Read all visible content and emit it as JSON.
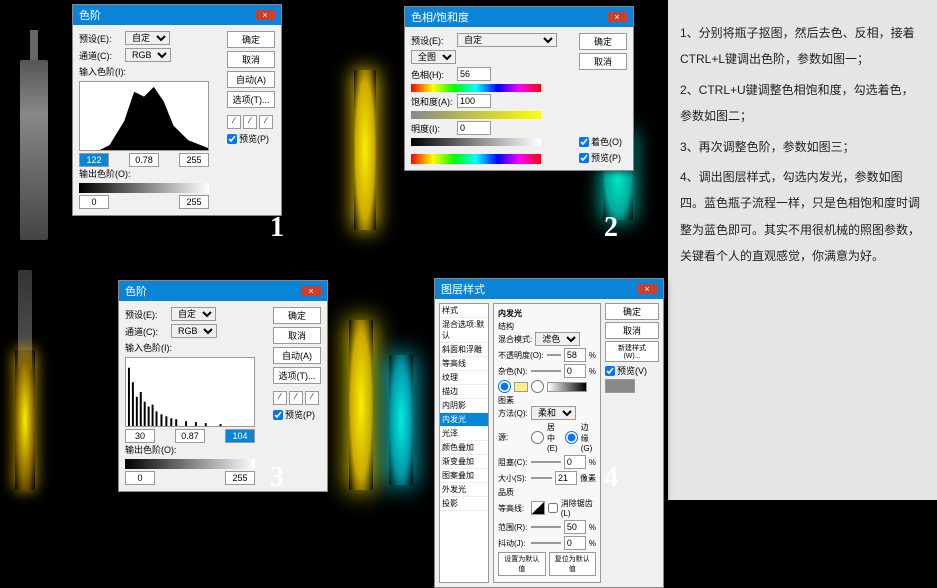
{
  "instructions": [
    "1、分别将瓶子抠图，然后去色、反相，接着CTRL+L键调出色阶，参数如图一；",
    "2、CTRL+U键调整色相饱和度，勾选着色，参数如图二；",
    "3、再次调整色阶，参数如图三；",
    "4、调出图层样式，勾选内发光，参数如图四。蓝色瓶子流程一样，只是色相饱和度时调整为蓝色即可。其实不用很机械的照图参数，关键看个人的直观感觉，你满意为好。"
  ],
  "nums": [
    "1",
    "2",
    "3",
    "4"
  ],
  "levels1": {
    "title": "色阶",
    "preset": "预设(E):",
    "preset_val": "自定",
    "channel": "通道(C):",
    "channel_val": "RGB",
    "input": "输入色阶(I):",
    "output": "输出色阶(O):",
    "in_low": "122",
    "in_mid": "0.78",
    "in_high": "255",
    "out_low": "0",
    "out_high": "255",
    "ok": "确定",
    "cancel": "取消",
    "auto": "自动(A)",
    "options": "选项(T)...",
    "preview": "预览(P)"
  },
  "hsl": {
    "title": "色相/饱和度",
    "preset": "预设(E):",
    "preset_val": "自定",
    "master": "全图",
    "hue": "色相(H):",
    "hue_val": "56",
    "sat": "饱和度(A):",
    "sat_val": "100",
    "light": "明度(I):",
    "light_val": "0",
    "colorize": "着色(O)",
    "preview": "预览(P)",
    "ok": "确定",
    "cancel": "取消"
  },
  "levels3": {
    "title": "色阶",
    "preset": "预设(E):",
    "preset_val": "自定",
    "channel": "通道(C):",
    "channel_val": "RGB",
    "input": "输入色阶(I):",
    "output": "输出色阶(O):",
    "in_low": "30",
    "in_mid": "0.87",
    "in_high": "104",
    "out_low": "0",
    "out_high": "255",
    "ok": "确定",
    "cancel": "取消",
    "auto": "自动(A)",
    "options": "选项(T)...",
    "preview": "预览(P)"
  },
  "layerStyle": {
    "title": "图层样式",
    "list": [
      "样式",
      "混合选项:默认",
      "斜面和浮雕",
      "等高线",
      "纹理",
      "描边",
      "内阴影",
      "内发光",
      "光泽",
      "颜色叠加",
      "渐变叠加",
      "图案叠加",
      "外发光",
      "投影"
    ],
    "active": "内发光",
    "section1": "结构",
    "section2": "图素",
    "section3": "品质",
    "blend": "混合模式:",
    "blend_val": "滤色",
    "opacity": "不透明度(O):",
    "opacity_val": "58",
    "pct": "%",
    "noise": "杂色(N):",
    "noise_val": "0",
    "method": "方法(Q):",
    "method_val": "柔和",
    "source": "源:",
    "center": "居中(E)",
    "edge": "边缘(G)",
    "choke": "阻塞(C):",
    "choke_val": "0",
    "size": "大小(S):",
    "size_val": "21",
    "px": "像素",
    "contour": "等高线:",
    "anti": "消除锯齿(L)",
    "range": "范围(R):",
    "range_val": "50",
    "jitter": "抖动(J):",
    "jitter_val": "0",
    "ok": "确定",
    "cancel": "取消",
    "newstyle": "新建样式(W)...",
    "preview": "预览(V)",
    "default": "设置为默认值",
    "reset": "复位为默认值"
  }
}
